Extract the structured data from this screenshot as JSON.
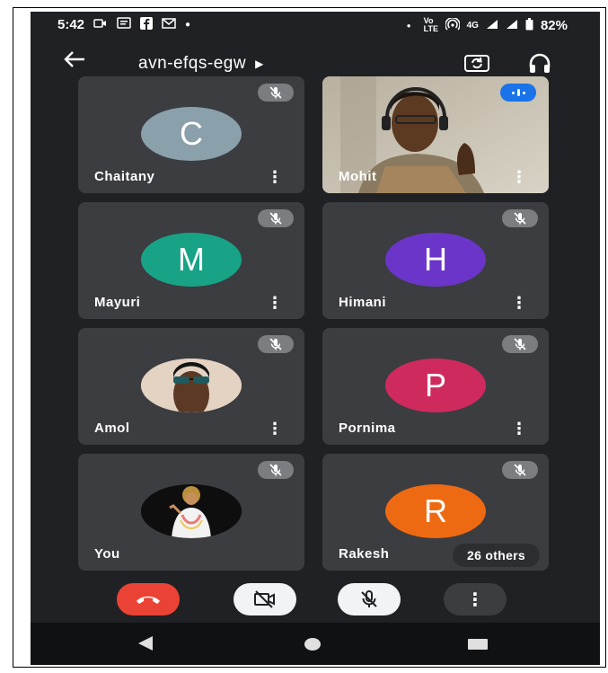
{
  "status_bar": {
    "time": "5:42",
    "network": "4G",
    "volte": "Vo LTE",
    "battery": "82%"
  },
  "header": {
    "meeting_code": "avn-efqs-egw"
  },
  "participants": [
    {
      "name": "Chaitany",
      "avatar_letter": "C",
      "avatar_color": "#8aa0ab",
      "muted": true
    },
    {
      "name": "Mohit",
      "avatar_letter": "",
      "avatar_color": "",
      "muted": false,
      "video": true
    },
    {
      "name": "Mayuri",
      "avatar_letter": "M",
      "avatar_color": "#18a386",
      "muted": true
    },
    {
      "name": "Himani",
      "avatar_letter": "H",
      "avatar_color": "#6b35c9",
      "muted": true
    },
    {
      "name": "Amol",
      "avatar_letter": "",
      "avatar_color": "#d9c3b0",
      "muted": true,
      "photo": true
    },
    {
      "name": "Pornima",
      "avatar_letter": "P",
      "avatar_color": "#cf2a5e",
      "muted": true
    },
    {
      "name": "You",
      "avatar_letter": "",
      "avatar_color": "#111111",
      "muted": true,
      "photo": true
    },
    {
      "name": "Rakesh",
      "avatar_letter": "R",
      "avatar_color": "#ee6a12",
      "muted": true
    }
  ],
  "others_label": "26 others",
  "colors": {
    "background": "#202124",
    "tile": "#3c3d40",
    "end_call": "#ea4335",
    "speaking": "#1a73e8"
  },
  "icons": {
    "back": "arrow-left-icon",
    "switch_camera": "switch-camera-icon",
    "audio": "headphones-icon",
    "end_call": "phone-hangup-icon",
    "camera": "video-off-icon",
    "mic": "mic-off-icon",
    "more": "more-vert-icon"
  }
}
